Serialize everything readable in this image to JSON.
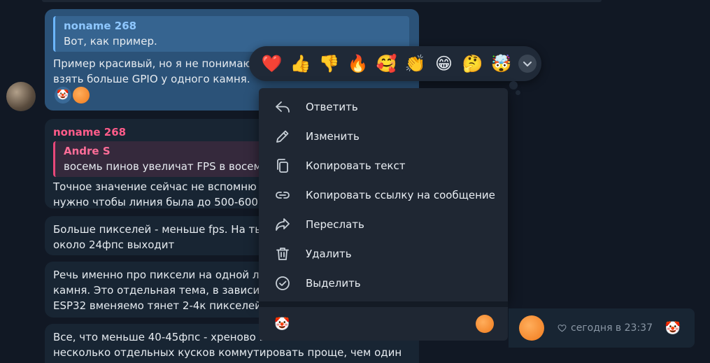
{
  "message1": {
    "quote_name": "noname 268",
    "quote_text": "Вот, как пример.",
    "line1": "Пример красивый, но я не понимаю",
    "line2": "взять больше GPIO у одного камня.",
    "reaction_emoji": "🤡"
  },
  "message2": {
    "sender": "noname 268",
    "quote_name": "Andre S",
    "quote_text": "восемь пинов увеличат FPS в восемь раз",
    "line1": "Точное значение сейчас не вспомню",
    "line2": "нужно чтобы линия была до 500-600 п"
  },
  "message3": {
    "line1": "Больше пикселей - меньше fps. На ты",
    "line2": "около 24фпс выходит"
  },
  "message4": {
    "line1": "Речь именно про пиксели на одной л",
    "line2": "камня. Это отдельная тема, в зависим",
    "line3": "ESP32 вменяемо тянет 2-4к пикселей"
  },
  "message5": {
    "line1": "Все, что меньше 40-45фпс - хреново в",
    "line2": "несколько отдельных кусков коммутировать проще, чем один"
  },
  "reactions": [
    {
      "emoji": "❤️",
      "icon": "heart-icon"
    },
    {
      "emoji": "👍",
      "icon": "thumbs-up-icon"
    },
    {
      "emoji": "👎",
      "icon": "thumbs-down-icon"
    },
    {
      "emoji": "🔥",
      "icon": "fire-icon"
    },
    {
      "emoji": "🥰",
      "icon": "smiling-hearts-icon"
    },
    {
      "emoji": "👏",
      "icon": "clapping-icon"
    },
    {
      "emoji": "😁",
      "icon": "grin-icon"
    },
    {
      "emoji": "🤔",
      "icon": "thinking-icon"
    },
    {
      "emoji": "🤯",
      "icon": "mind-blown-icon"
    }
  ],
  "context_menu": {
    "items": [
      {
        "label": "Ответить",
        "icon": "reply-icon"
      },
      {
        "label": "Изменить",
        "icon": "pencil-icon"
      },
      {
        "label": "Копировать текст",
        "icon": "copy-icon"
      },
      {
        "label": "Копировать ссылку на сообщение",
        "icon": "link-icon"
      },
      {
        "label": "Переслать",
        "icon": "forward-icon"
      },
      {
        "label": "Удалить",
        "icon": "trash-icon"
      },
      {
        "label": "Выделить",
        "icon": "check-circle-icon"
      }
    ],
    "footer_emoji": "🤡"
  },
  "seen_panel": {
    "time": "сегодня в 23:37",
    "emoji": "🤡"
  }
}
